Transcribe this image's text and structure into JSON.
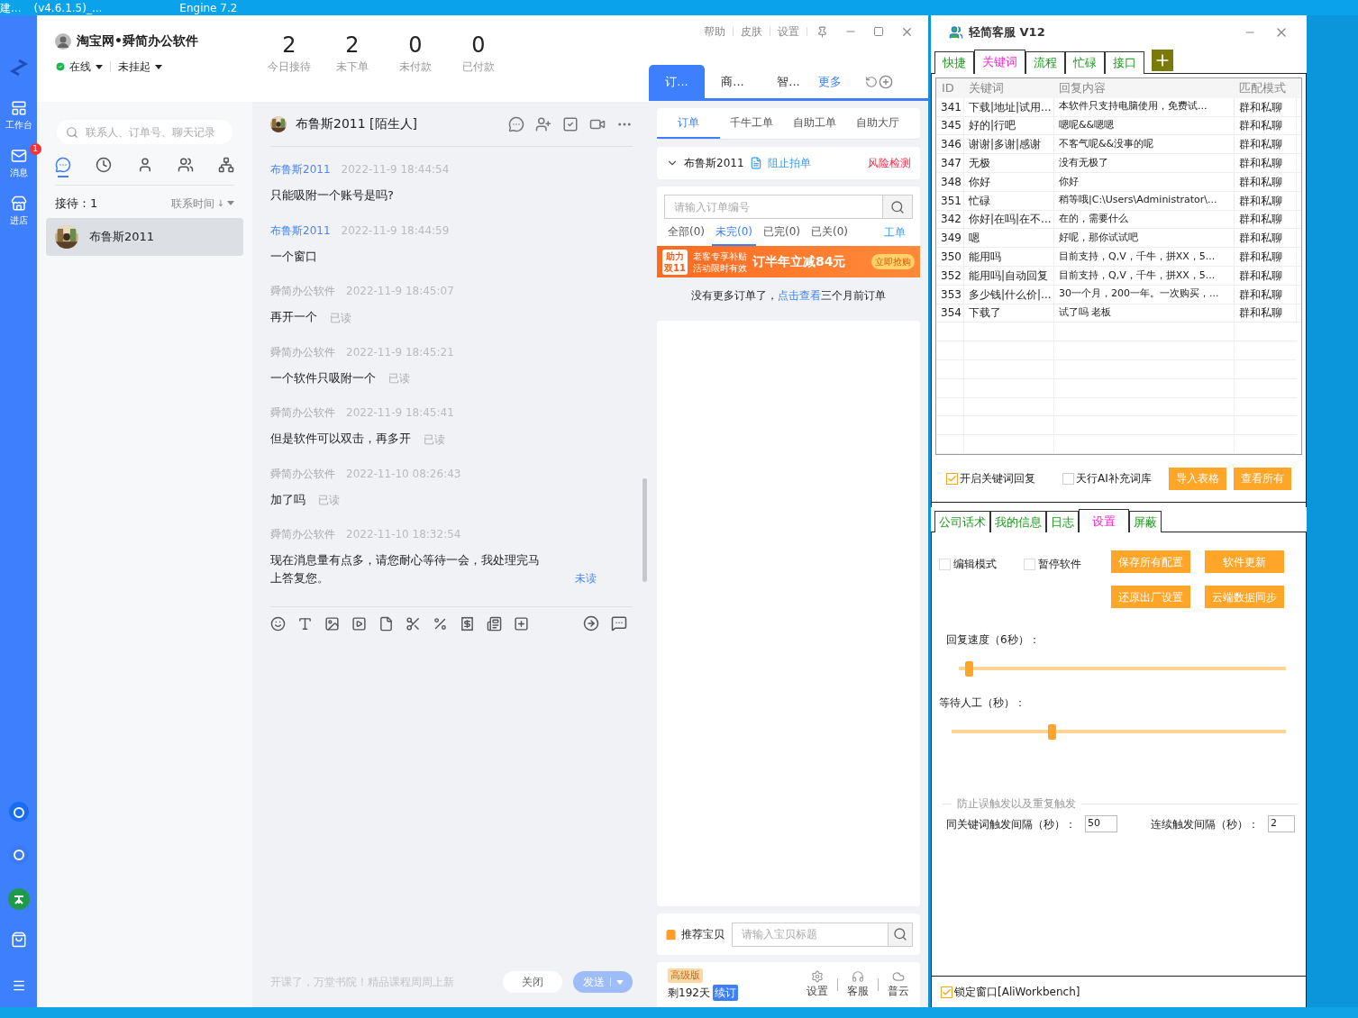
{
  "taskbar": {
    "items": [
      "建...",
      "(v4.6.1.5)_...",
      "Engine 7.2"
    ]
  },
  "sidebar": {
    "items": [
      {
        "kind": "desk",
        "label": "工作台"
      },
      {
        "kind": "mail",
        "label": "消息",
        "badge": "1"
      },
      {
        "kind": "shop",
        "label": "进店"
      }
    ]
  },
  "account": {
    "name": "淘宝网•舜简办公软件",
    "status": "在线",
    "hang": "未挂起"
  },
  "stats": [
    {
      "value": "2",
      "label": "今日接待"
    },
    {
      "value": "2",
      "label": "未下单"
    },
    {
      "value": "0",
      "label": "未付款"
    },
    {
      "value": "0",
      "label": "已付款"
    }
  ],
  "contacts": {
    "search": {
      "placeholder": "联系人、订单号、聊天记录"
    },
    "tabs": [
      {
        "kind": "chat",
        "selected": true
      },
      {
        "kind": "recent",
        "selected": false
      },
      {
        "kind": "contact",
        "selected": false
      },
      {
        "kind": "group",
        "selected": false
      },
      {
        "kind": "org",
        "selected": false
      }
    ],
    "count": "接待：1",
    "sort": "联系时间",
    "sort_arrow": "↓",
    "items": [
      {
        "name": "布鲁斯2011",
        "selected": true
      }
    ]
  },
  "chat": {
    "title": "布鲁斯2011 [陌生人]",
    "messages": [
      {
        "kind": "in",
        "sender": "布鲁斯2011",
        "time": "2022-11-9 18:44:54",
        "text": "只能吸附一个账号是吗?"
      },
      {
        "kind": "in",
        "sender": "布鲁斯2011",
        "time": "2022-11-9 18:44:59",
        "text": "一个窗口"
      },
      {
        "kind": "out",
        "sender": "舜简办公软件",
        "time": "2022-11-9 18:45:07",
        "text": "再开一个",
        "status": "已读",
        "read": true
      },
      {
        "kind": "out",
        "sender": "舜简办公软件",
        "time": "2022-11-9 18:45:21",
        "text": "一个软件只吸附一个",
        "status": "已读",
        "read": true
      },
      {
        "kind": "out",
        "sender": "舜简办公软件",
        "time": "2022-11-9 18:45:41",
        "text": "但是软件可以双击，再多开",
        "status": "已读",
        "read": true
      },
      {
        "kind": "out",
        "sender": "舜简办公软件",
        "time": "2022-11-10 08:26:43",
        "text": "加了吗",
        "status": "已读",
        "read": true
      },
      {
        "kind": "out",
        "sender": "舜简办公软件",
        "time": "2022-11-10 18:32:54",
        "text": "现在消息量有点多，请您耐心等待一会，我处理完马上答复您。",
        "status": "未读",
        "read": false
      }
    ],
    "notice": "开课了，万堂书院！精品课程周周上新",
    "close": "关闭",
    "send": "发送"
  },
  "orders": {
    "menu": [
      "帮助",
      "皮肤",
      "设置"
    ],
    "tabs": [
      {
        "label": "订...",
        "selected": true
      },
      {
        "label": "商...",
        "selected": false
      },
      {
        "label": "智...",
        "selected": false
      }
    ],
    "more": "更多",
    "subtabs": [
      {
        "label": "订单",
        "selected": true
      },
      {
        "label": "千牛工单",
        "selected": false
      },
      {
        "label": "自助工单",
        "selected": false
      },
      {
        "label": "自助大厅",
        "selected": false
      }
    ],
    "customer": "布鲁斯2011",
    "block": "阻止拍单",
    "risk": "风险检测",
    "search": {
      "placeholder": "请输入订单编号"
    },
    "filters": [
      {
        "label": "全部(0)",
        "selected": false
      },
      {
        "label": "未完(0)",
        "selected": true
      },
      {
        "label": "已完(0)",
        "selected": false
      },
      {
        "label": "已关(0)",
        "selected": false
      }
    ],
    "workorder": "工单",
    "banner": {
      "badge_top": "助力",
      "badge_bottom": "双11",
      "line1": "老客专享补贴",
      "line2": "活动限时有效",
      "headline": "订半年立减84元",
      "cta": "立即抢购"
    },
    "empty": {
      "text": "没有更多订单了，",
      "link": "点击查看",
      "tail": "三个月前订单"
    },
    "recommend": {
      "label": "推荐宝贝",
      "placeholder": "请输入宝贝标题"
    },
    "plan": {
      "badge": "高级版",
      "remaining": "剩192天",
      "renew": "续订"
    },
    "tools": [
      {
        "kind": "settings",
        "label": "设置"
      },
      {
        "kind": "service",
        "label": "客服"
      },
      {
        "kind": "cloud",
        "label": "普云"
      }
    ]
  },
  "bot": {
    "title": "轻简客服 V12",
    "tabs": [
      {
        "label": "快捷",
        "selected": false
      },
      {
        "label": "关键词",
        "selected": true
      },
      {
        "label": "流程",
        "selected": false
      },
      {
        "label": "忙碌",
        "selected": false
      },
      {
        "label": "接口",
        "selected": false
      }
    ],
    "columns": [
      "ID",
      "关键词",
      "回复内容",
      "匹配模式"
    ],
    "rows": [
      {
        "id": "341",
        "keyword": "下载|地址|试用...",
        "reply": "本软件只支持电脑使用，免费试...",
        "mode": "群和私聊"
      },
      {
        "id": "345",
        "keyword": "好的|行吧",
        "reply": "嗯呢&&嗯嗯",
        "mode": "群和私聊"
      },
      {
        "id": "346",
        "keyword": "谢谢|多谢|感谢",
        "reply": "不客气呢&&没事的呢",
        "mode": "群和私聊"
      },
      {
        "id": "347",
        "keyword": "无极",
        "reply": "没有无极了",
        "mode": "群和私聊"
      },
      {
        "id": "348",
        "keyword": "你好",
        "reply": "你好",
        "mode": "群和私聊"
      },
      {
        "id": "351",
        "keyword": "忙碌",
        "reply": "稍等哦|C:\\Users\\Administrator\\...",
        "mode": "群和私聊"
      },
      {
        "id": "342",
        "keyword": "你好|在吗|在不...",
        "reply": "在的，需要什么",
        "mode": "群和私聊"
      },
      {
        "id": "349",
        "keyword": "嗯",
        "reply": "好呢，那你试试吧",
        "mode": "群和私聊"
      },
      {
        "id": "350",
        "keyword": "能用吗",
        "reply": "目前支持，Q,V，千牛，拼XX，5...",
        "mode": "群和私聊"
      },
      {
        "id": "352",
        "keyword": "能用吗|自动回复",
        "reply": "目前支持，Q,V，千牛，拼XX，5...",
        "mode": "群和私聊"
      },
      {
        "id": "353",
        "keyword": "多少钱|什么价|...",
        "reply": "30一个月，200一年。一次购买，...",
        "mode": "群和私聊"
      },
      {
        "id": "354",
        "keyword": "下载了",
        "reply": "试了吗 老板",
        "mode": "群和私聊"
      }
    ],
    "options": [
      {
        "label": "开启关键词回复",
        "checked": true
      },
      {
        "label": "天行AI补充词库",
        "checked": false
      }
    ],
    "buttons": [
      "导入表格",
      "查看所有"
    ],
    "tabs2": [
      {
        "label": "公司话术",
        "selected": false
      },
      {
        "label": "我的信息",
        "selected": false
      },
      {
        "label": "日志",
        "selected": false
      },
      {
        "label": "设置",
        "selected": true
      },
      {
        "label": "屏蔽",
        "selected": false
      }
    ],
    "checks": [
      {
        "label": "编辑模式",
        "checked": false
      },
      {
        "label": "暂停软件",
        "checked": false
      }
    ],
    "actions": [
      "保存所有配置",
      "软件更新",
      "还原出厂设置",
      "云端数据同步"
    ],
    "sliders": [
      {
        "label": "回复速度（6秒）：",
        "level": 0.03
      },
      {
        "label": "等待人工（秒）：",
        "level": 0.3
      }
    ],
    "group": {
      "title": "防止误触发以及重复触发",
      "fields": [
        {
          "label": "同关键词触发间隔（秒）：",
          "value": "50"
        },
        {
          "label": "连续触发间隔（秒）：",
          "value": "2"
        }
      ]
    },
    "lock": {
      "label": "锁定窗口[AliWorkbench]",
      "checked": true
    }
  }
}
